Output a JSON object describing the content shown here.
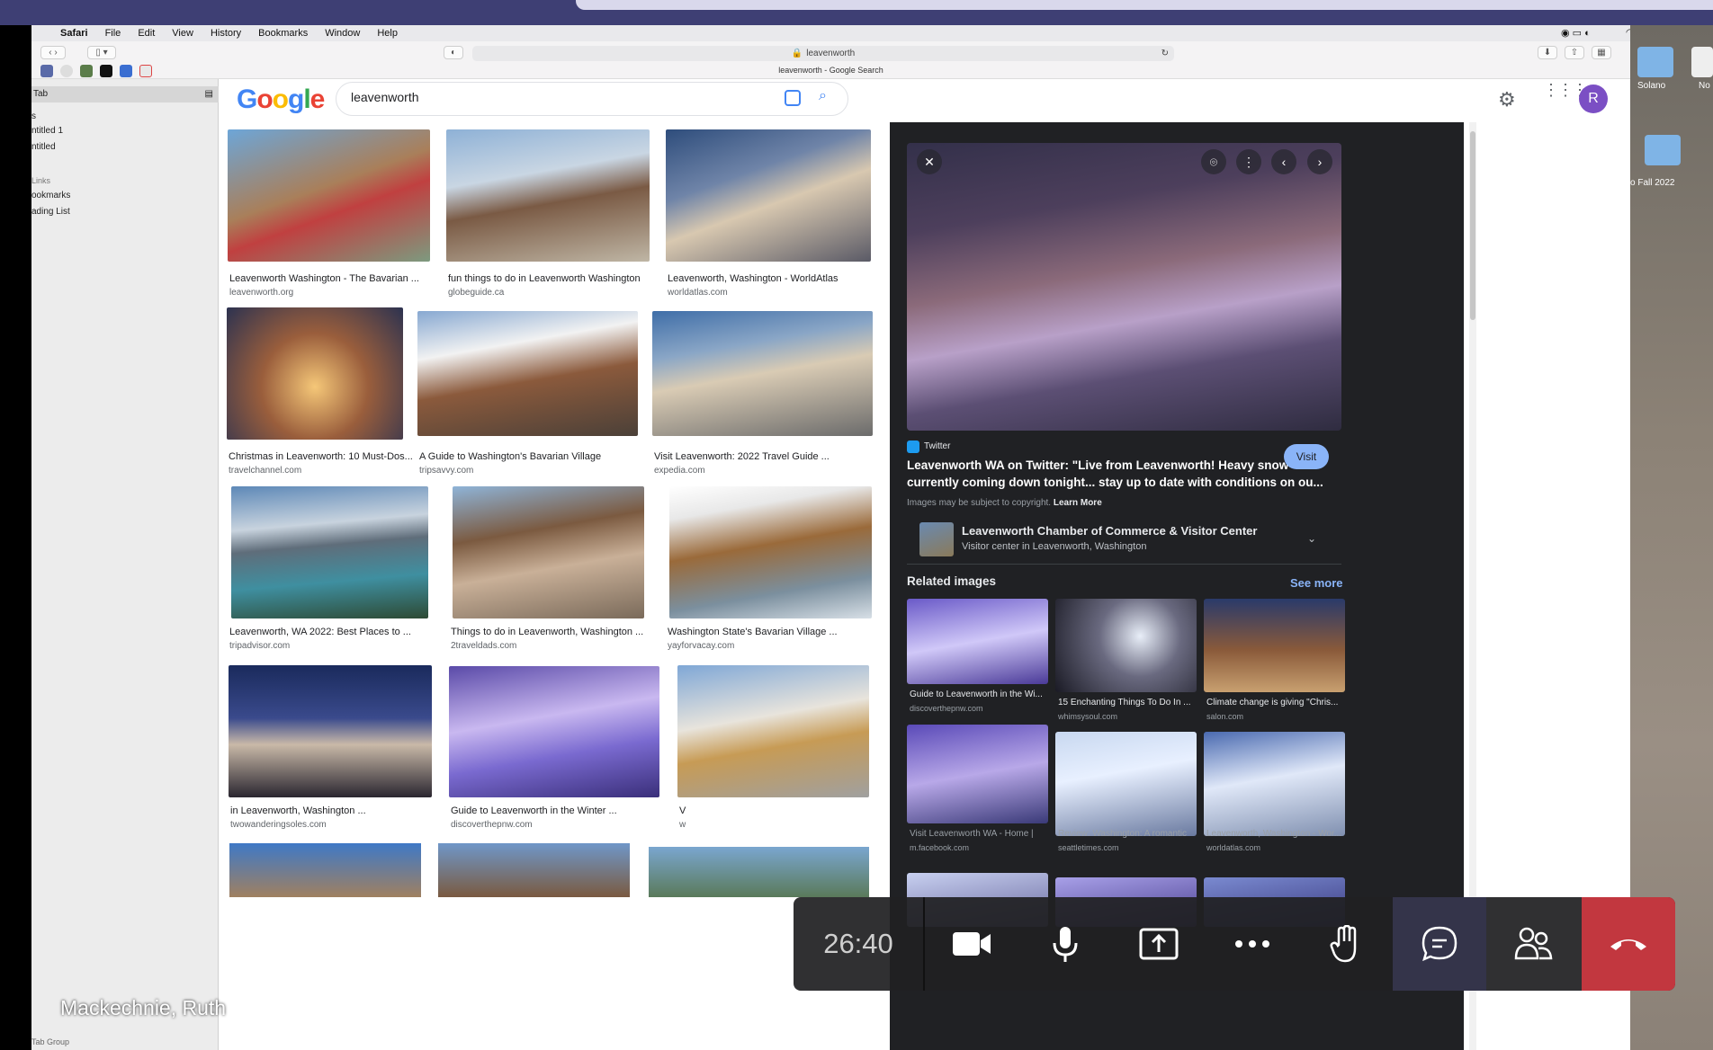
{
  "menubar": {
    "app": "Safari",
    "items": [
      "File",
      "Edit",
      "View",
      "History",
      "Bookmarks",
      "Window",
      "Help"
    ]
  },
  "browser": {
    "url": "leavenworth",
    "tab_title": "leavenworth - Google Search"
  },
  "sidebar": {
    "header": "Tab",
    "items": [
      "s",
      "ntitled 1",
      "ntitled",
      "Links",
      "ookmarks",
      "ading List"
    ],
    "footer": "Tab Group"
  },
  "desktop": {
    "items": [
      "Solano",
      "No",
      "o Fall 2022"
    ]
  },
  "google": {
    "logo": "Google",
    "query": "leavenworth",
    "avatar": "R",
    "colors": {
      "blue": "#4285F4",
      "red": "#EA4335",
      "yellow": "#FBBC05",
      "green": "#34A853"
    }
  },
  "results": [
    {
      "title": "Leavenworth Washington - The Bavarian ...",
      "source": "leavenworth.org"
    },
    {
      "title": "fun things to do in Leavenworth Washington",
      "source": "globeguide.ca"
    },
    {
      "title": "Leavenworth, Washington - WorldAtlas",
      "source": "worldatlas.com"
    },
    {
      "title": "Christmas in Leavenworth: 10 Must-Dos...",
      "source": "travelchannel.com"
    },
    {
      "title": "A Guide to Washington's Bavarian Village",
      "source": "tripsavvy.com"
    },
    {
      "title": "Visit Leavenworth: 2022 Travel Guide ...",
      "source": "expedia.com"
    },
    {
      "title": "Leavenworth, WA 2022: Best Places to ...",
      "source": "tripadvisor.com"
    },
    {
      "title": "Things to do in Leavenworth, Washington ...",
      "source": "2traveldads.com"
    },
    {
      "title": "Washington State's Bavarian Village ...",
      "source": "yayforvacay.com"
    },
    {
      "title": "in Leavenworth, Washington ...",
      "source": "twowanderingsoles.com"
    },
    {
      "title": "Guide to Leavenworth in the Winter ...",
      "source": "discoverthepnw.com"
    },
    {
      "title": "V",
      "source": "w"
    }
  ],
  "panel": {
    "source_name": "Twitter",
    "title_line1": "Leavenworth WA on Twitter: \"Live from Leavenworth! Heavy snow",
    "title_line2": "currently coming down tonight... stay up to date with conditions on ou...",
    "visit_label": "Visit",
    "copyright": "Images may be subject to copyright.",
    "learn_more": "Learn More",
    "entity_name": "Leavenworth Chamber of Commerce & Visitor Center",
    "entity_desc": "Visitor center in Leavenworth, Washington",
    "related_heading": "Related images",
    "see_more": "See more",
    "related": [
      {
        "title": "Guide to Leavenworth in the Wi...",
        "source": "discoverthepnw.com"
      },
      {
        "title": "15 Enchanting Things To Do In ...",
        "source": "whimsysoul.com"
      },
      {
        "title": "Climate change is giving \"Chris...",
        "source": "salon.com"
      },
      {
        "title": "Visit Leavenworth WA - Home |",
        "source": "m.facebook.com"
      },
      {
        "title": "Review: Washington: A romantic",
        "source": "seattletimes.com"
      },
      {
        "title": "Leavenworth, Washington - Wor...",
        "source": "worldatlas.com"
      }
    ]
  },
  "call": {
    "timer": "26:40",
    "participant": "Mackechnie, Ruth"
  }
}
